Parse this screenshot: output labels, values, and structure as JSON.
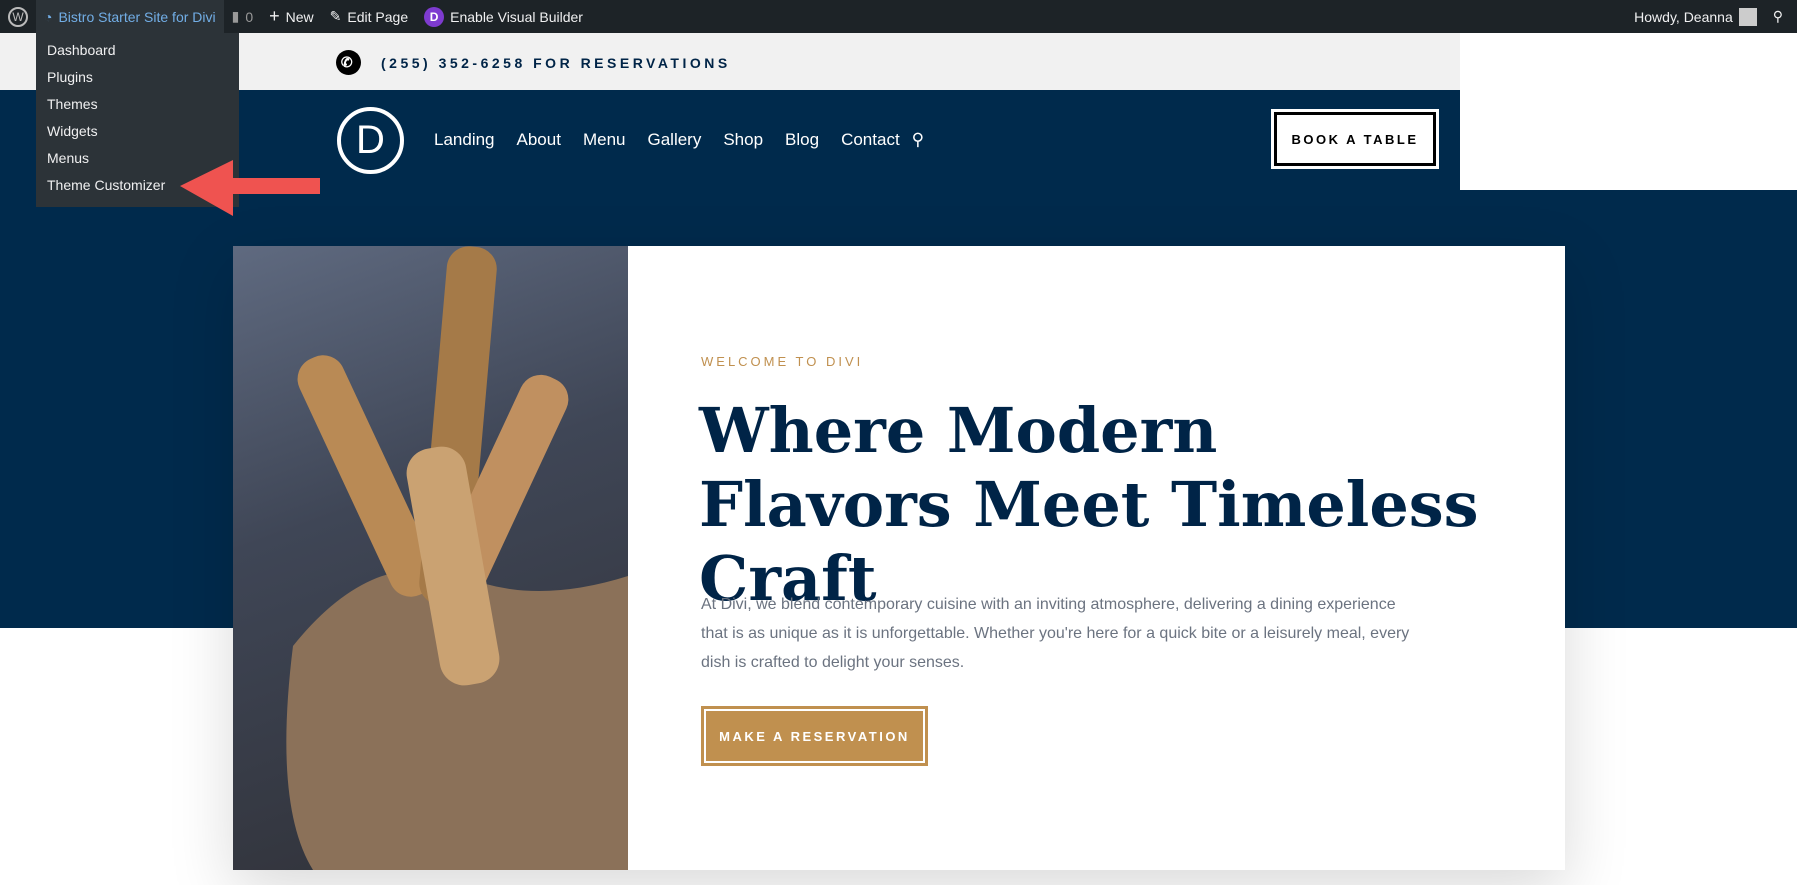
{
  "adminbar": {
    "site": "Bistro Starter Site for Divi",
    "comments": "0",
    "new": "New",
    "edit": "Edit Page",
    "visual_builder": "Enable Visual Builder",
    "howdy": "Howdy, Deanna"
  },
  "dropdown": [
    "Dashboard",
    "Plugins",
    "Themes",
    "Widgets",
    "Menus",
    "Theme Customizer"
  ],
  "topbar": {
    "phone": "(255) 352-6258 FOR RESERVATIONS"
  },
  "nav": {
    "logo": "D",
    "items": [
      "Landing",
      "About",
      "Menu",
      "Gallery",
      "Shop",
      "Blog",
      "Contact"
    ],
    "book": "BOOK A TABLE"
  },
  "hero": {
    "eyebrow": "WELCOME TO DIVI",
    "title": "Where Modern Flavors Meet Timeless Craft",
    "description": "At Divi, we blend contemporary cuisine with an inviting atmosphere, delivering a dining experience that is as unique as it is unforgettable. Whether you're here for a quick bite or a leisurely meal, every dish is crafted to delight your senses.",
    "button": "MAKE A RESERVATION"
  },
  "colors": {
    "navy": "#002a4c",
    "gold": "#c0904f",
    "arrow": "#ef5350"
  }
}
